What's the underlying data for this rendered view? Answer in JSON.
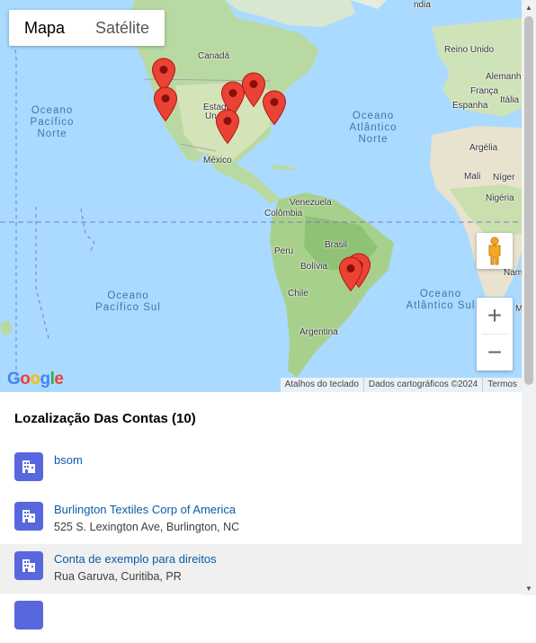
{
  "map": {
    "type_buttons": [
      {
        "label": "Mapa",
        "active": true
      },
      {
        "label": "Satélite",
        "active": false
      }
    ],
    "labels": {
      "canada": "Canadá",
      "estados": "Estados",
      "unidos": "Un",
      "mexico": "México",
      "venezuela": "Venezuela",
      "colombia": "Colômbia",
      "peru": "Peru",
      "brasil": "Brasil",
      "bolivia": "Bolívia",
      "chile": "Chile",
      "argentina": "Argentina",
      "reino_unido": "Reino Unido",
      "alemanha": "Alemanha",
      "franca": "França",
      "espanha": "Espanha",
      "italia": "Itália",
      "argelia": "Argélia",
      "mali": "Mali",
      "niger": "Níger",
      "nigeria": "Nigéria",
      "namibia": "Nami",
      "madagascar": "M",
      "top_right": "ndia"
    },
    "oceans": {
      "pacifico_norte": "Oceano\nPacífico\nNorte",
      "atlantico_norte": "Oceano\nAtlântico\nNorte",
      "pacifico_sul": "Oceano\nPacífico Sul",
      "atlantico_sul": "Oceano\nAtlântico Sul"
    },
    "google_logo": "Google",
    "attribution": [
      "Atalhos do teclado",
      "Dados cartográficos ©2024",
      "Termos"
    ],
    "zoom_in": "+",
    "zoom_out": "−",
    "marker_color": "#ea4335"
  },
  "list": {
    "title": "Lozalização Das Contas (10)",
    "items": [
      {
        "name": "bsom",
        "address": ""
      },
      {
        "name": "Burlington Textiles Corp of America",
        "address": "525 S. Lexington Ave, Burlington, NC"
      },
      {
        "name": "Conta de exemplo para direitos",
        "address": "Rua Garuva, Curitiba, PR"
      }
    ]
  },
  "colors": {
    "accent_icon": "#5867dd",
    "link": "#0b5cab"
  }
}
